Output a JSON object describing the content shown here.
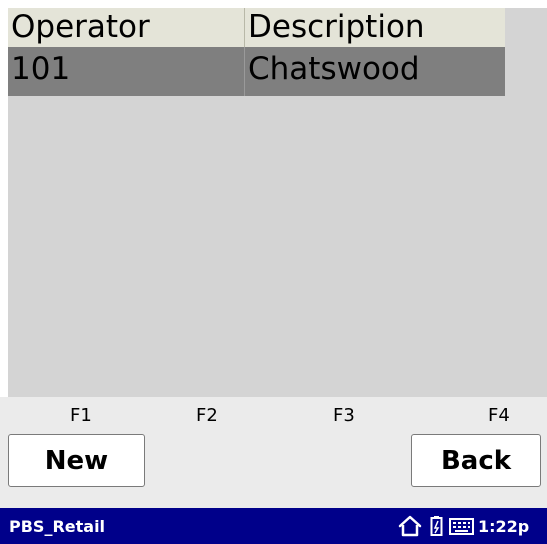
{
  "table": {
    "headers": [
      "Operator",
      "Description"
    ],
    "rows": [
      {
        "operator": "101",
        "description": "Chatswood"
      }
    ]
  },
  "fkeys": [
    "F1",
    "F2",
    "F3",
    "F4"
  ],
  "buttons": {
    "new_label": "New",
    "back_label": "Back"
  },
  "taskbar": {
    "app_name": "PBS_Retail",
    "time": "1:22p",
    "icons": [
      "home-icon",
      "battery-icon",
      "keyboard-icon"
    ]
  },
  "colors": {
    "taskbar": "#00008a",
    "selected_row": "#7f7f7f",
    "content_bg": "#d4d4d4",
    "header_bg": "#e4e4d8"
  }
}
